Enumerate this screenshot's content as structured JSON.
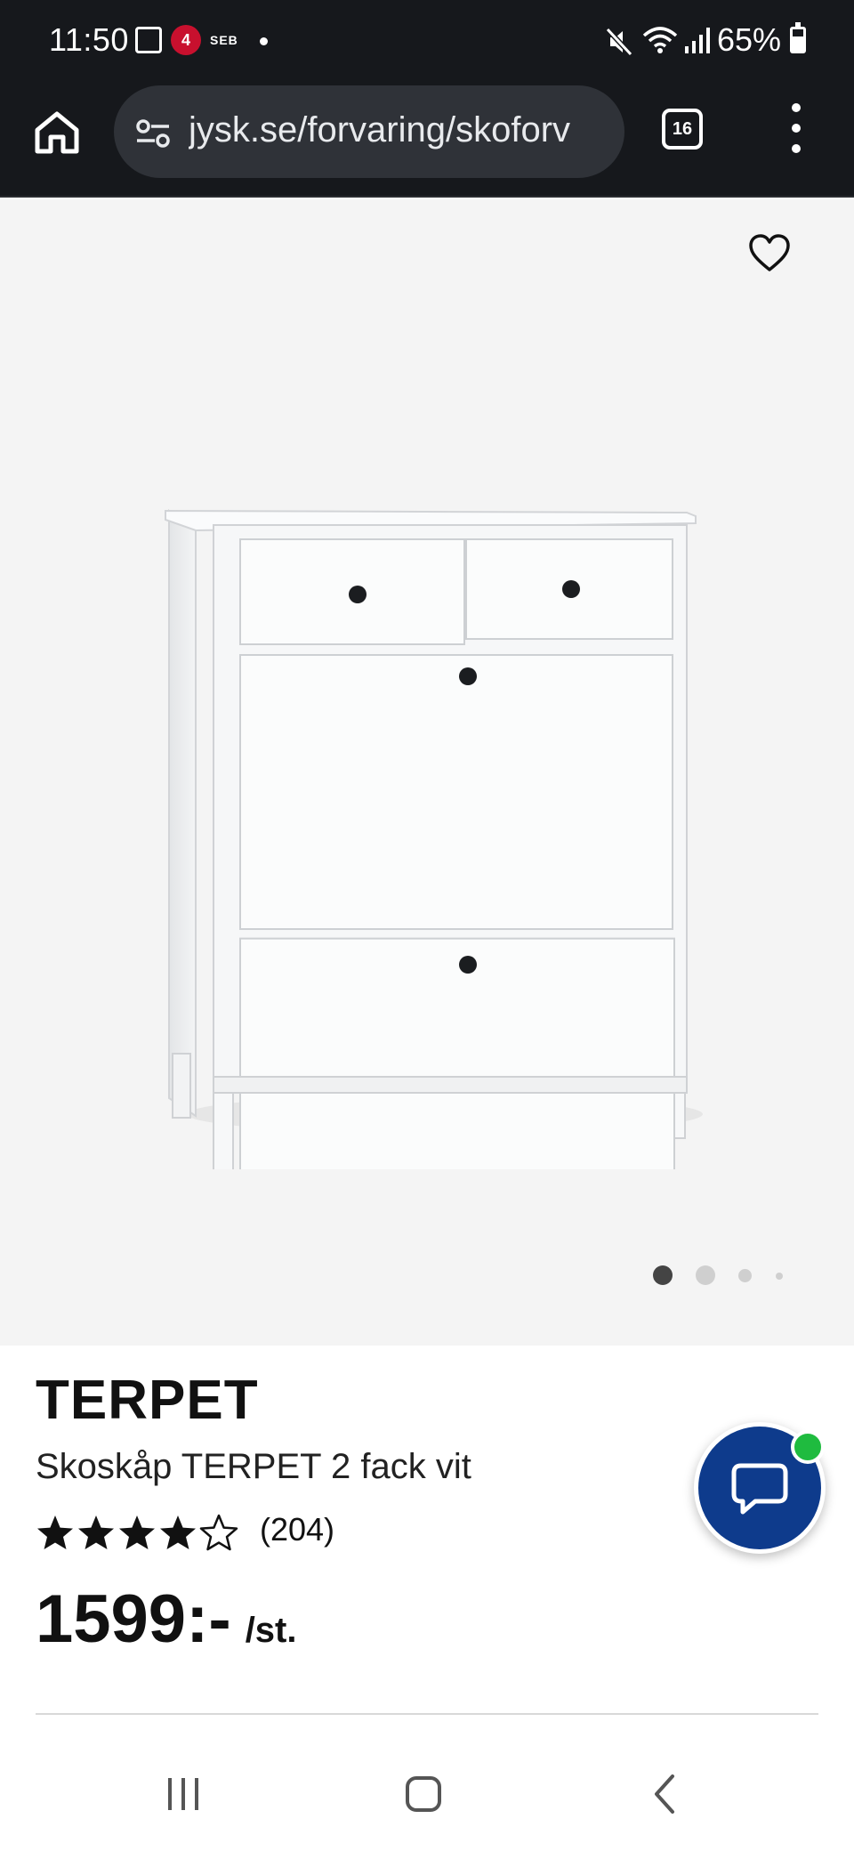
{
  "status_bar": {
    "time": "11:50",
    "badge_text": "4",
    "seb_text": "SEB",
    "battery": "65%"
  },
  "browser": {
    "url": "jysk.se/forvaring/skoforv",
    "tab_count": "16"
  },
  "gallery": {
    "image_count": 4,
    "active_index": 0
  },
  "product": {
    "brand": "TERPET",
    "name": "Skoskåp TERPET 2 fack vit",
    "rating": 4,
    "rating_max": 5,
    "review_count": "(204)",
    "price": "1599:-",
    "unit": "/st."
  },
  "colors": {
    "chat_fab": "#0e3b8c",
    "online": "#1fbb3f",
    "status_bar": "#16181c"
  },
  "icons": {
    "home": "home-icon",
    "site_settings": "tune-icon",
    "favorite": "heart-outline-icon",
    "chat": "chat-bubble-icon",
    "nav_recents": "recents-icon",
    "nav_home": "home-square-icon",
    "nav_back": "back-chevron-icon"
  }
}
